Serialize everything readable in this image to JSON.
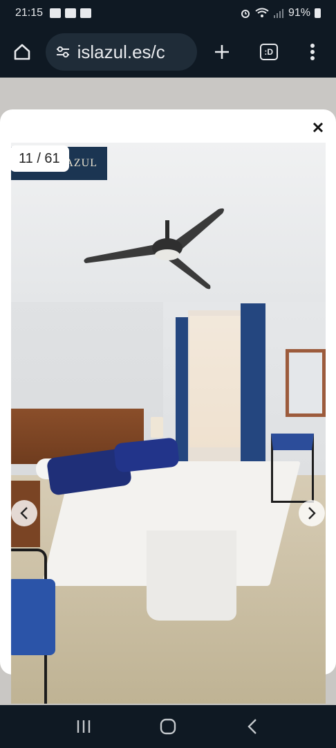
{
  "status_bar": {
    "time": "21:15",
    "battery": "91%",
    "icons": [
      "gallery-icon",
      "nadiya-app-icon",
      "sigma-app-icon",
      "alarm-icon",
      "wifi-icon",
      "signal-icon",
      "battery-icon"
    ]
  },
  "browser": {
    "url_text": "islazul.es/c",
    "tab_count_label": ":D"
  },
  "gallery": {
    "counter": "11 / 61",
    "logo_text": "LAZUL",
    "photo_description": "bedroom-with-ceiling-fan-double-bed-blue-curtains"
  },
  "colors": {
    "chrome_bg": "#0f1923",
    "pill_bg": "#1f2c38",
    "brand_navy": "#1b3552",
    "accent_blue": "#24467f"
  }
}
